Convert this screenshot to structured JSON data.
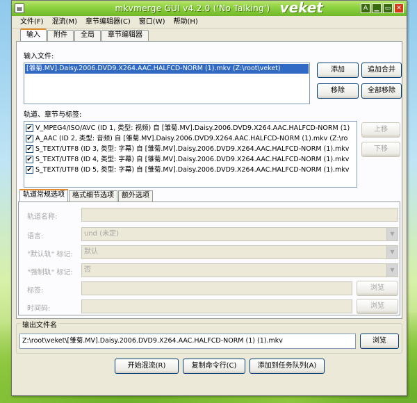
{
  "window": {
    "title": "mkvmerge GUI v4.2.0 ('No Talking')",
    "brand": "veket",
    "controls": [
      "A",
      "▁",
      "▭",
      "✕"
    ]
  },
  "menu": [
    {
      "label": "文件(F)"
    },
    {
      "label": "混流(M)"
    },
    {
      "label": "章节编辑器(C)"
    },
    {
      "label": "窗口(W)"
    },
    {
      "label": "帮助(H)"
    }
  ],
  "tabs": [
    {
      "label": "输入"
    },
    {
      "label": "附件"
    },
    {
      "label": "全局"
    },
    {
      "label": "章节编辑器"
    }
  ],
  "input": {
    "label": "输入文件:",
    "files": [
      "[雏菊.MV].Daisy.2006.DVD9.X264.AAC.HALFCD-NORM (1).mkv (Z:\\root\\veket)"
    ],
    "buttons": {
      "add": "添加",
      "append": "追加合并",
      "remove": "移除",
      "remove_all": "全部移除"
    }
  },
  "tracks": {
    "label": "轨道、章节与标签:",
    "items": [
      {
        "text": "V_MPEG4/ISO/AVC (ID 1, 类型: 视频) 自 [雏菊.MV].Daisy.2006.DVD9.X264.AAC.HALFCD-NORM (1)",
        "checked": true
      },
      {
        "text": "A_AAC (ID 2, 类型: 音频) 自 [雏菊.MV].Daisy.2006.DVD9.X264.AAC.HALFCD-NORM (1).mkv (Z:\\ro",
        "checked": true
      },
      {
        "text": "S_TEXT/UTF8 (ID 3, 类型: 字幕) 自 [雏菊.MV].Daisy.2006.DVD9.X264.AAC.HALFCD-NORM (1).mkv",
        "checked": true
      },
      {
        "text": "S_TEXT/UTF8 (ID 4, 类型: 字幕) 自 [雏菊.MV].Daisy.2006.DVD9.X264.AAC.HALFCD-NORM (1).mkv",
        "checked": true
      },
      {
        "text": "S_TEXT/UTF8 (ID 5, 类型: 字幕) 自 [雏菊.MV].Daisy.2006.DVD9.X264.AAC.HALFCD-NORM (1).mkv",
        "checked": true
      }
    ],
    "buttons": {
      "up": "上移",
      "down": "下移"
    },
    "check_mark": "✔"
  },
  "options": {
    "tabs": [
      {
        "label": "轨道常规选项"
      },
      {
        "label": "格式细节选项"
      },
      {
        "label": "额外选项"
      }
    ],
    "fields": {
      "track_name": {
        "label": "轨道名称:",
        "value": ""
      },
      "language": {
        "label": "语言:",
        "value": "und (未定)"
      },
      "default_track": {
        "label": "\"默认轨\" 标记:",
        "value": "默认"
      },
      "forced_track": {
        "label": "\"强制轨\" 标记:",
        "value": "否"
      },
      "tags": {
        "label": "标签:",
        "value": "",
        "browse": "浏览"
      },
      "timecodes": {
        "label": "时间码:",
        "value": "",
        "browse": "浏览"
      }
    },
    "dropdown_arrow": "▼"
  },
  "output": {
    "label": "输出文件名",
    "value": "Z:\\root\\veket\\[雏菊.MV].Daisy.2006.DVD9.X264.AAC.HALFCD-NORM (1) (1).mkv",
    "browse": "浏览"
  },
  "actions": {
    "start": "开始混流(R)",
    "copy": "复制命令行(C)",
    "queue": "添加到任务队列(A)"
  }
}
